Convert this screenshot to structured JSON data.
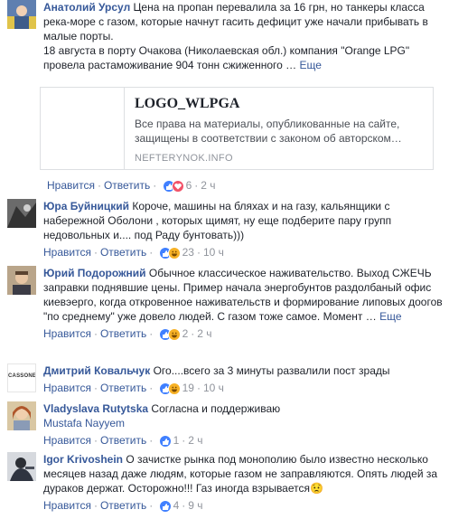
{
  "actions": {
    "like": "Нравится",
    "reply": "Ответить",
    "dot": "·",
    "more": "Еще"
  },
  "comments": [
    {
      "author": "Анатолий Урсул",
      "text": "Цена на пропан перевалила за 16 грн, но танкеры класса река-море с газом, которые начнут гасить дефицит уже начали прибывать в малые порты.",
      "text2": "18 августа в порту Очакова (Николаевская обл.) компания \"Orange LPG\" провела растаможивание 904 тонн сжиженного …",
      "reactions": 6,
      "time": "2 ч",
      "reaction_icons": [
        "like-icon",
        "love-icon"
      ]
    },
    {
      "author": "Юра Буйницкий",
      "text": "Короче, машины на бляхах и на газу, кальянщики с набережной Оболони , которых щимят, ну еще подберите пару групп недовольных и.... под Раду бунтовать)))",
      "reactions": 23,
      "time": "10 ч",
      "reaction_icons": [
        "like-icon",
        "haha-icon"
      ]
    },
    {
      "author": "Юрий Подорожний",
      "text": "Обычное классическое наживательство. Выход СЖЕЧЬ заправки поднявшие цены. Пример начала энергобунтов раздолбаный офис киевэерго, когда откровенное наживательств и формирование липовых доогов \"по среднему\" уже довело людей. С газом тоже самое. Момент …",
      "reactions": 2,
      "time": "2 ч",
      "reaction_icons": [
        "like-icon",
        "haha-icon"
      ]
    },
    {
      "author": "Дмитрий Ковальчук",
      "text": "Ого....всего за 3 минуты развалили пост зрады",
      "reactions": 19,
      "time": "10 ч",
      "avatar_text": "CASSONE",
      "reaction_icons": [
        "like-icon",
        "haha-icon"
      ]
    },
    {
      "author": "Vladyslava Rutytska",
      "text": "Согласна и поддерживаю",
      "mention": "Mustafa Nayyem",
      "reactions": 1,
      "time": "2 ч",
      "reaction_icons": [
        "like-icon"
      ]
    },
    {
      "author": "Igor Krivoshein",
      "text": "О зачистке рынка под монополию было известно несколько месяцев назад даже людям, которые газом не заправляются. Опять людей за дураков держат. Осторожно!!! Газ иногда взрывается😟",
      "reactions": 4,
      "time": "9 ч",
      "reaction_icons": [
        "like-icon"
      ]
    }
  ],
  "link_preview": {
    "title": "LOGO_WLPGA",
    "description": "Все права на материалы, опубликованные на сайте, защищены в соответствии с законом об авторском…",
    "source": "NEFTERYNOK.INFO"
  },
  "colors": {
    "link": "#365899",
    "meta": "#90949c",
    "like": "#4080ff",
    "love": "#f25268",
    "haha": "#f7b125"
  }
}
